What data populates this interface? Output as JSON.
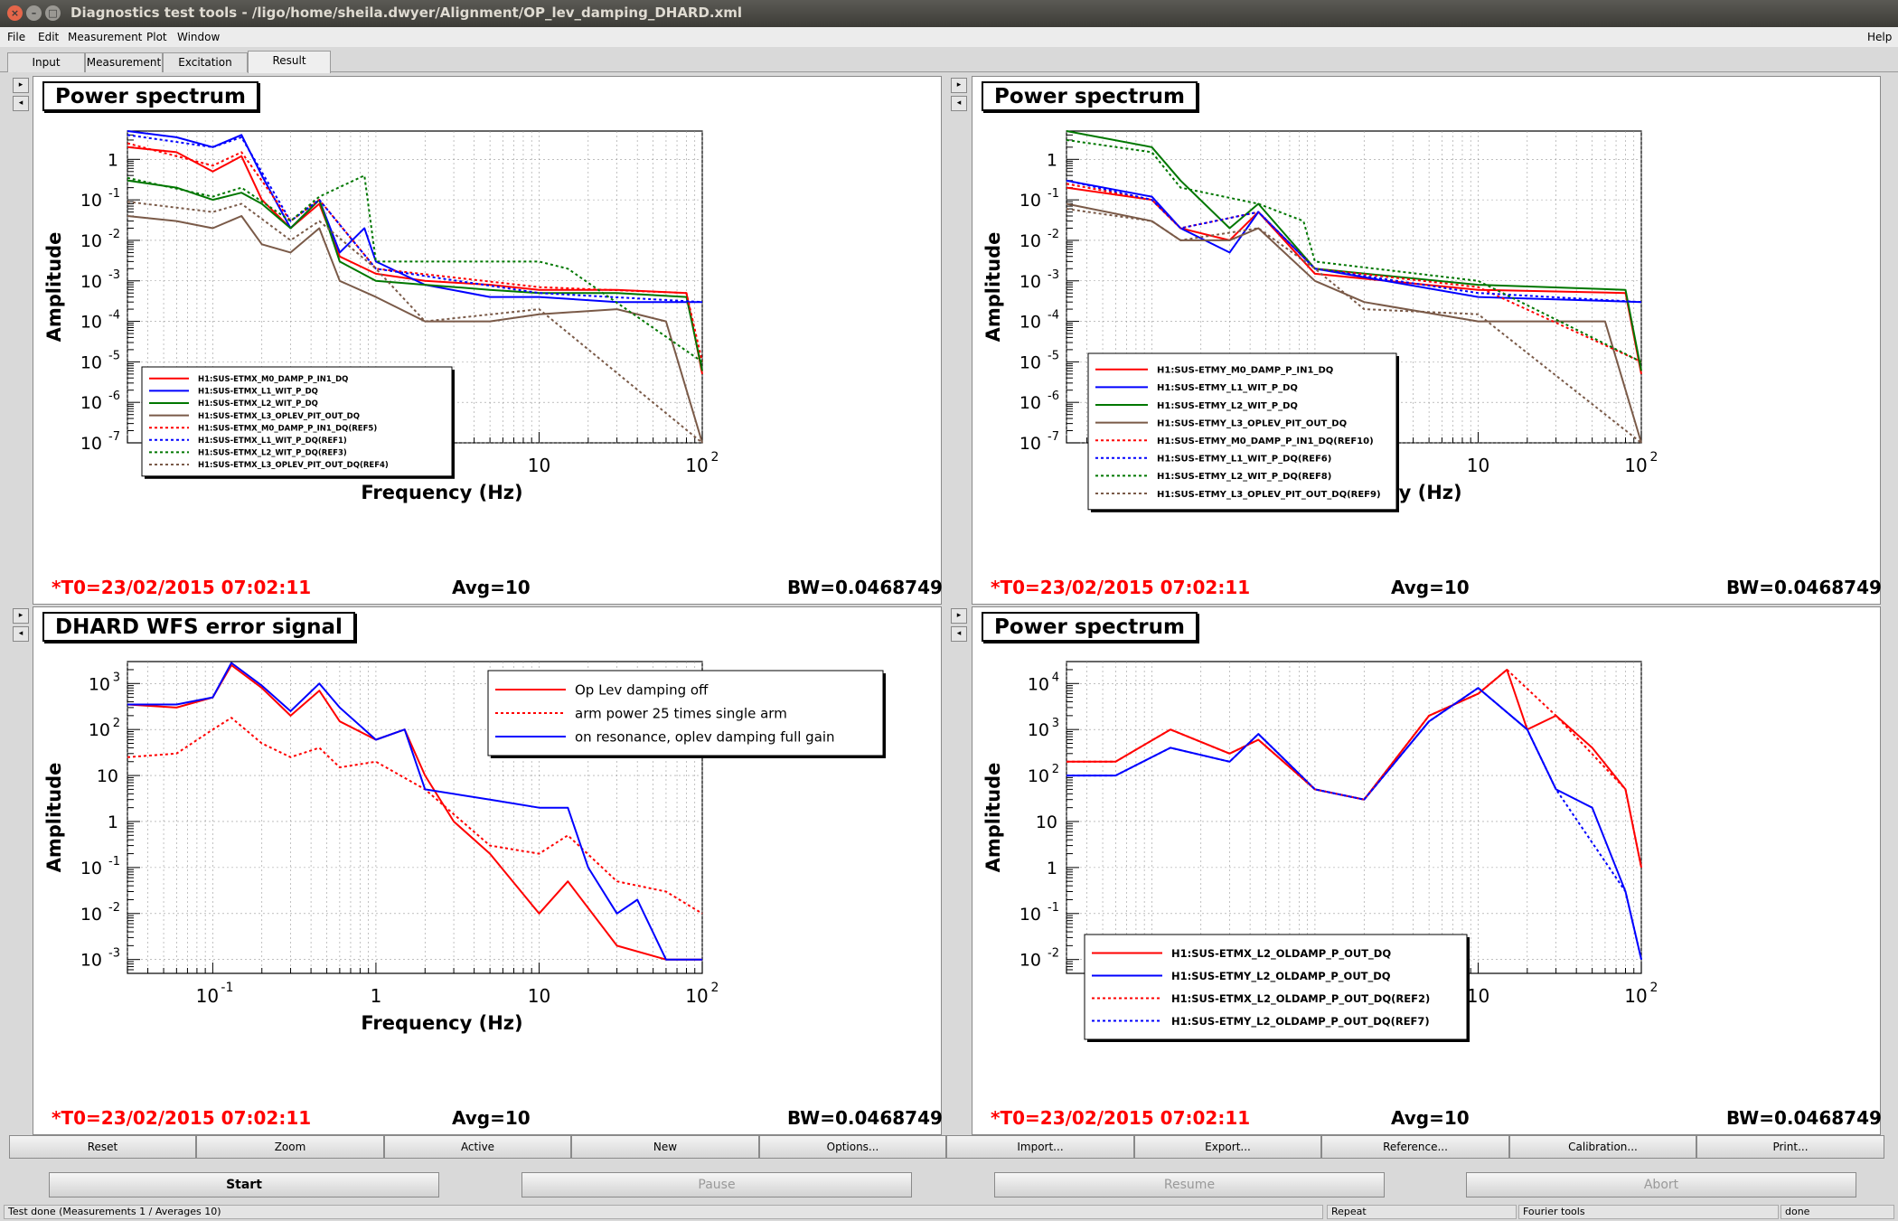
{
  "window": {
    "title": "Diagnostics test tools - /ligo/home/sheila.dwyer/Alignment/OP_lev_damping_DHARD.xml",
    "help": "Help"
  },
  "menu": [
    "File",
    "Edit",
    "Measurement",
    "Plot",
    "Window"
  ],
  "tabs": [
    "Input",
    "Measurement",
    "Excitation",
    "Result"
  ],
  "axes": {
    "xlabel": "Frequency (Hz)",
    "ylabel": "Amplitude",
    "xticks": [
      "10",
      "-1",
      "1",
      "10",
      "10",
      "2"
    ]
  },
  "panels": [
    {
      "title": "Power spectrum",
      "t0": "*T0=23/02/2015 07:02:11",
      "avg": "Avg=10",
      "bw": "BW=0.0468749",
      "legend": [
        "H1:SUS-ETMX_M0_DAMP_P_IN1_DQ",
        "H1:SUS-ETMX_L1_WIT_P_DQ",
        "H1:SUS-ETMX_L2_WIT_P_DQ",
        "H1:SUS-ETMX_L3_OPLEV_PIT_OUT_DQ",
        "H1:SUS-ETMX_M0_DAMP_P_IN1_DQ(REF5)",
        "H1:SUS-ETMX_L1_WIT_P_DQ(REF1)",
        "H1:SUS-ETMX_L2_WIT_P_DQ(REF3)",
        "H1:SUS-ETMX_L3_OPLEV_PIT_OUT_DQ(REF4)"
      ]
    },
    {
      "title": "Power spectrum",
      "t0": "*T0=23/02/2015 07:02:11",
      "avg": "Avg=10",
      "bw": "BW=0.0468749",
      "legend": [
        "H1:SUS-ETMY_M0_DAMP_P_IN1_DQ",
        "H1:SUS-ETMY_L1_WIT_P_DQ",
        "H1:SUS-ETMY_L2_WIT_P_DQ",
        "H1:SUS-ETMY_L3_OPLEV_PIT_OUT_DQ",
        "H1:SUS-ETMY_M0_DAMP_P_IN1_DQ(REF10)",
        "H1:SUS-ETMY_L1_WIT_P_DQ(REF6)",
        "H1:SUS-ETMY_L2_WIT_P_DQ(REF8)",
        "H1:SUS-ETMY_L3_OPLEV_PIT_OUT_DQ(REF9)"
      ]
    },
    {
      "title": "DHARD WFS error signal",
      "t0": "*T0=23/02/2015 07:02:11",
      "avg": "Avg=10",
      "bw": "BW=0.0468749",
      "legend": [
        "Op Lev damping off",
        "arm power 25 times single arm",
        "on resonance, oplev damping full gain"
      ]
    },
    {
      "title": "Power spectrum",
      "t0": "*T0=23/02/2015 07:02:11",
      "avg": "Avg=10",
      "bw": "BW=0.0468749",
      "legend": [
        "H1:SUS-ETMX_L2_OLDAMP_P_OUT_DQ",
        "H1:SUS-ETMY_L2_OLDAMP_P_OUT_DQ",
        "H1:SUS-ETMX_L2_OLDAMP_P_OUT_DQ(REF2)",
        "H1:SUS-ETMY_L2_OLDAMP_P_OUT_DQ(REF7)"
      ]
    }
  ],
  "buttons": [
    "Reset",
    "Zoom",
    "Active",
    "New",
    "Options...",
    "Import...",
    "Export...",
    "Reference...",
    "Calibration...",
    "Print..."
  ],
  "controls": [
    "Start",
    "Pause",
    "Resume",
    "Abort"
  ],
  "status": [
    "Test done (Measurements 1 / Averages 10)",
    "Repeat",
    "Fourier tools",
    "done"
  ],
  "colors": {
    "red": "#ff0000",
    "blue": "#0000ff",
    "green": "#007700",
    "brown": "#7a5a48",
    "accent": "#ff0000"
  },
  "chart_data": [
    {
      "type": "line",
      "xscale": "log",
      "yscale": "log",
      "xlim": [
        0.03,
        100
      ],
      "ylim": [
        1e-07,
        5
      ],
      "series": [
        {
          "name": "H1:SUS-ETMX_M0_DAMP_P_IN1_DQ",
          "color": "red",
          "style": "solid",
          "x": [
            0.03,
            0.06,
            0.1,
            0.15,
            0.2,
            0.3,
            0.45,
            0.6,
            1,
            2,
            5,
            10,
            30,
            80,
            100
          ],
          "y": [
            2,
            1.5,
            0.5,
            1.2,
            0.1,
            0.02,
            0.08,
            0.004,
            0.0015,
            0.001,
            0.0008,
            0.0006,
            0.0006,
            0.0005,
            5e-06
          ]
        },
        {
          "name": "H1:SUS-ETMX_L1_WIT_P_DQ",
          "color": "blue",
          "style": "solid",
          "x": [
            0.03,
            0.06,
            0.1,
            0.15,
            0.2,
            0.3,
            0.45,
            0.6,
            0.85,
            1,
            2,
            5,
            10,
            30,
            100
          ],
          "y": [
            5,
            3.5,
            2,
            4,
            0.4,
            0.02,
            0.1,
            0.005,
            0.02,
            0.003,
            0.0008,
            0.0004,
            0.0004,
            0.0003,
            0.0003
          ]
        },
        {
          "name": "H1:SUS-ETMX_L2_WIT_P_DQ",
          "color": "green",
          "style": "solid",
          "x": [
            0.03,
            0.06,
            0.1,
            0.15,
            0.2,
            0.3,
            0.45,
            0.6,
            1,
            2,
            5,
            10,
            30,
            80,
            100
          ],
          "y": [
            0.3,
            0.2,
            0.1,
            0.15,
            0.08,
            0.02,
            0.1,
            0.003,
            0.001,
            0.0008,
            0.0006,
            0.0005,
            0.0005,
            0.0004,
            6e-06
          ]
        },
        {
          "name": "H1:SUS-ETMX_L3_OPLEV_PIT_OUT_DQ",
          "color": "brown",
          "style": "solid",
          "x": [
            0.03,
            0.06,
            0.1,
            0.15,
            0.2,
            0.3,
            0.45,
            0.6,
            1,
            2,
            5,
            10,
            30,
            60,
            100
          ],
          "y": [
            0.04,
            0.03,
            0.02,
            0.04,
            0.008,
            0.005,
            0.02,
            0.001,
            0.0004,
            0.0001,
            0.0001,
            0.00015,
            0.0002,
            0.0001,
            1e-07
          ]
        },
        {
          "name": "H1:SUS-ETMX_M0_DAMP_P_IN1_DQ(REF5)",
          "color": "red",
          "style": "dotted",
          "x": [
            0.03,
            0.1,
            0.15,
            0.3,
            0.45,
            1,
            10,
            80,
            100
          ],
          "y": [
            2.5,
            0.7,
            1.5,
            0.03,
            0.1,
            0.002,
            0.0007,
            0.0005,
            1e-05
          ]
        },
        {
          "name": "H1:SUS-ETMX_L1_WIT_P_DQ(REF1)",
          "color": "blue",
          "style": "dotted",
          "x": [
            0.03,
            0.1,
            0.15,
            0.3,
            0.45,
            1,
            10,
            100
          ],
          "y": [
            4,
            2,
            3.5,
            0.03,
            0.1,
            0.002,
            0.0005,
            0.0003
          ]
        },
        {
          "name": "H1:SUS-ETMX_L2_WIT_P_DQ(REF3)",
          "color": "green",
          "style": "dotted",
          "x": [
            0.03,
            0.1,
            0.15,
            0.3,
            0.45,
            0.85,
            1,
            10,
            15,
            100
          ],
          "y": [
            0.35,
            0.12,
            0.2,
            0.03,
            0.12,
            0.4,
            0.003,
            0.003,
            0.002,
            1e-05
          ]
        },
        {
          "name": "H1:SUS-ETMX_L3_OPLEV_PIT_OUT_DQ(REF4)",
          "color": "brown",
          "style": "dotted",
          "x": [
            0.03,
            0.1,
            0.15,
            0.3,
            0.45,
            1,
            2,
            10,
            100
          ],
          "y": [
            0.09,
            0.05,
            0.08,
            0.01,
            0.03,
            0.002,
            0.0001,
            0.0002,
            1e-07
          ]
        }
      ]
    },
    {
      "type": "line",
      "xscale": "log",
      "yscale": "log",
      "xlim": [
        0.03,
        100
      ],
      "ylim": [
        1e-07,
        5
      ],
      "series": [
        {
          "name": "H1:SUS-ETMY_M0_DAMP_P_IN1_DQ",
          "color": "red",
          "style": "solid",
          "x": [
            0.03,
            0.1,
            0.15,
            0.3,
            0.45,
            1,
            10,
            80,
            100
          ],
          "y": [
            0.2,
            0.1,
            0.02,
            0.01,
            0.05,
            0.0015,
            0.0006,
            0.0005,
            5e-06
          ]
        },
        {
          "name": "H1:SUS-ETMY_L1_WIT_P_DQ",
          "color": "blue",
          "style": "solid",
          "x": [
            0.03,
            0.1,
            0.15,
            0.3,
            0.45,
            1,
            10,
            100
          ],
          "y": [
            0.3,
            0.12,
            0.02,
            0.005,
            0.05,
            0.002,
            0.0004,
            0.0003
          ]
        },
        {
          "name": "H1:SUS-ETMY_L2_WIT_P_DQ",
          "color": "green",
          "style": "solid",
          "x": [
            0.03,
            0.1,
            0.15,
            0.3,
            0.45,
            1,
            10,
            80,
            100
          ],
          "y": [
            5,
            2,
            0.3,
            0.02,
            0.08,
            0.002,
            0.0008,
            0.0006,
            6e-06
          ]
        },
        {
          "name": "H1:SUS-ETMY_L3_OPLEV_PIT_OUT_DQ",
          "color": "brown",
          "style": "solid",
          "x": [
            0.03,
            0.1,
            0.15,
            0.3,
            0.45,
            1,
            2,
            10,
            60,
            100
          ],
          "y": [
            0.08,
            0.03,
            0.01,
            0.01,
            0.02,
            0.001,
            0.0003,
            0.0001,
            0.0001,
            1e-07
          ]
        },
        {
          "name": "H1:SUS-ETMY_M0_DAMP_P_IN1_DQ(REF10)",
          "color": "red",
          "style": "dotted",
          "x": [
            0.03,
            0.1,
            0.15,
            0.45,
            1,
            10,
            100
          ],
          "y": [
            0.25,
            0.1,
            0.02,
            0.05,
            0.002,
            0.0007,
            1e-05
          ]
        },
        {
          "name": "H1:SUS-ETMY_L1_WIT_P_DQ(REF6)",
          "color": "blue",
          "style": "dotted",
          "x": [
            0.03,
            0.1,
            0.15,
            0.45,
            1,
            10,
            100
          ],
          "y": [
            0.3,
            0.1,
            0.02,
            0.05,
            0.002,
            0.0005,
            0.0003
          ]
        },
        {
          "name": "H1:SUS-ETMY_L2_WIT_P_DQ(REF8)",
          "color": "green",
          "style": "dotted",
          "x": [
            0.03,
            0.1,
            0.15,
            0.45,
            0.85,
            1,
            10,
            100
          ],
          "y": [
            3,
            1.5,
            0.2,
            0.08,
            0.03,
            0.003,
            0.001,
            1e-05
          ]
        },
        {
          "name": "H1:SUS-ETMY_L3_OPLEV_PIT_OUT_DQ(REF9)",
          "color": "brown",
          "style": "dotted",
          "x": [
            0.03,
            0.1,
            0.15,
            0.45,
            1,
            2,
            10,
            100
          ],
          "y": [
            0.06,
            0.03,
            0.01,
            0.02,
            0.002,
            0.0002,
            0.00015,
            1e-07
          ]
        }
      ]
    },
    {
      "type": "line",
      "xscale": "log",
      "yscale": "log",
      "xlim": [
        0.03,
        100
      ],
      "ylim": [
        0.0005,
        3000
      ],
      "series": [
        {
          "name": "Op Lev damping off",
          "color": "red",
          "style": "solid",
          "x": [
            0.03,
            0.06,
            0.1,
            0.13,
            0.2,
            0.3,
            0.45,
            0.6,
            1,
            1.5,
            2,
            3,
            5,
            10,
            15,
            30,
            60,
            100
          ],
          "y": [
            350,
            300,
            500,
            2500,
            800,
            200,
            700,
            150,
            60,
            100,
            10,
            1,
            0.2,
            0.01,
            0.05,
            0.002,
            0.001,
            0.001
          ]
        },
        {
          "name": "arm power 25 times single arm",
          "color": "red",
          "style": "dotted",
          "x": [
            0.03,
            0.06,
            0.1,
            0.13,
            0.2,
            0.3,
            0.45,
            0.6,
            1,
            2,
            5,
            10,
            15,
            30,
            60,
            100
          ],
          "y": [
            25,
            30,
            100,
            180,
            50,
            25,
            40,
            15,
            20,
            5,
            0.3,
            0.2,
            0.5,
            0.05,
            0.03,
            0.01
          ]
        },
        {
          "name": "on resonance, oplev damping full gain",
          "color": "blue",
          "style": "solid",
          "x": [
            0.03,
            0.06,
            0.1,
            0.13,
            0.2,
            0.3,
            0.45,
            0.6,
            1,
            1.5,
            2,
            5,
            10,
            15,
            20,
            30,
            40,
            60,
            100
          ],
          "y": [
            350,
            350,
            500,
            2800,
            900,
            250,
            1000,
            300,
            60,
            100,
            5,
            3,
            2,
            2,
            0.1,
            0.01,
            0.02,
            0.001,
            0.001
          ]
        }
      ]
    },
    {
      "type": "line",
      "xscale": "log",
      "yscale": "log",
      "xlim": [
        0.03,
        100
      ],
      "ylim": [
        0.005,
        30000
      ],
      "series": [
        {
          "name": "H1:SUS-ETMX_L2_OLDAMP_P_OUT_DQ",
          "color": "red",
          "style": "solid",
          "x": [
            0.03,
            0.06,
            0.13,
            0.3,
            0.45,
            1,
            2,
            5,
            10,
            15,
            20,
            30,
            50,
            80,
            100
          ],
          "y": [
            200,
            200,
            1000,
            300,
            600,
            50,
            30,
            2000,
            6000,
            20000,
            1000,
            2000,
            400,
            50,
            1
          ]
        },
        {
          "name": "H1:SUS-ETMY_L2_OLDAMP_P_OUT_DQ",
          "color": "blue",
          "style": "solid",
          "x": [
            0.03,
            0.06,
            0.13,
            0.3,
            0.45,
            1,
            2,
            5,
            10,
            20,
            30,
            50,
            80,
            100
          ],
          "y": [
            100,
            100,
            400,
            200,
            800,
            50,
            30,
            1500,
            8000,
            1000,
            50,
            20,
            0.3,
            0.01
          ]
        },
        {
          "name": "H1:SUS-ETMX_L2_OLDAMP_P_OUT_DQ(REF2)",
          "color": "red",
          "style": "dotted",
          "x": [
            0.03,
            0.06,
            0.13,
            0.3,
            0.45,
            1,
            2,
            5,
            10,
            15,
            30,
            80,
            100
          ],
          "y": [
            200,
            200,
            1000,
            300,
            600,
            50,
            30,
            2000,
            6000,
            20000,
            2000,
            50,
            1
          ]
        },
        {
          "name": "H1:SUS-ETMY_L2_OLDAMP_P_OUT_DQ(REF7)",
          "color": "blue",
          "style": "dotted",
          "x": [
            0.03,
            0.06,
            0.13,
            0.3,
            0.45,
            1,
            2,
            5,
            10,
            20,
            30,
            80,
            100
          ],
          "y": [
            100,
            100,
            400,
            200,
            800,
            50,
            30,
            1500,
            8000,
            1000,
            50,
            0.3,
            0.01
          ]
        }
      ]
    }
  ]
}
